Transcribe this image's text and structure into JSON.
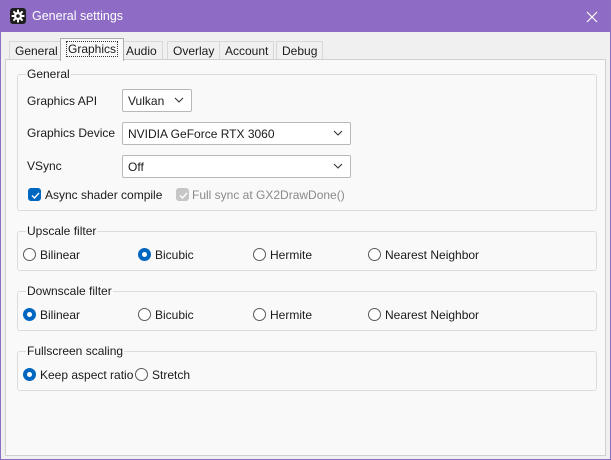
{
  "window": {
    "title": "General settings"
  },
  "tabs": [
    {
      "label": "General"
    },
    {
      "label": "Graphics"
    },
    {
      "label": "Audio"
    },
    {
      "label": "Overlay"
    },
    {
      "label": "Account"
    },
    {
      "label": "Debug"
    }
  ],
  "active_tab": "Graphics",
  "general": {
    "legend": "General",
    "api_label": "Graphics API",
    "api_value": "Vulkan",
    "device_label": "Graphics Device",
    "device_value": "NVIDIA GeForce RTX 3060",
    "vsync_label": "VSync",
    "vsync_value": "Off",
    "async_label": "Async shader compile",
    "async_checked": true,
    "fullsync_label": "Full sync at GX2DrawDone()",
    "fullsync_checked": true,
    "fullsync_enabled": false
  },
  "upscale": {
    "legend": "Upscale filter",
    "options": [
      "Bilinear",
      "Bicubic",
      "Hermite",
      "Nearest Neighbor"
    ],
    "selected": "Bicubic"
  },
  "downscale": {
    "legend": "Downscale filter",
    "options": [
      "Bilinear",
      "Bicubic",
      "Hermite",
      "Nearest Neighbor"
    ],
    "selected": "Bilinear"
  },
  "fullscreen": {
    "legend": "Fullscreen scaling",
    "options": [
      "Keep aspect ratio",
      "Stretch"
    ],
    "selected": "Keep aspect ratio"
  },
  "colors": {
    "titlebar": "#8e6cc6",
    "accent": "#0067c0"
  },
  "icons": {
    "app": "gear-icon",
    "close": "close-icon",
    "dropdown": "chevron-down-icon"
  }
}
